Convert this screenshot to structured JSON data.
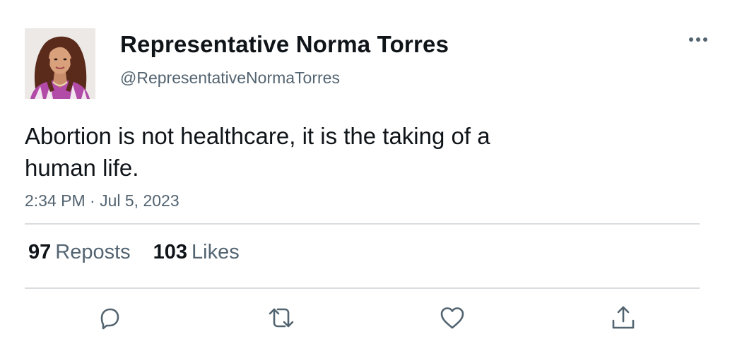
{
  "author": {
    "display_name": "Representative Norma Torres",
    "handle": "@RepresentativeNormaTorres",
    "avatar": "profile-photo"
  },
  "tweet": {
    "text": "Abortion is not healthcare, it is the taking of a human life.",
    "timestamp": "2:34 PM · Jul 5, 2023"
  },
  "stats": {
    "reposts_count": "97",
    "reposts_label": "Reposts",
    "likes_count": "103",
    "likes_label": "Likes"
  },
  "actions": [
    {
      "icon": "reply-icon"
    },
    {
      "icon": "repost-icon"
    },
    {
      "icon": "like-icon"
    },
    {
      "icon": "share-icon"
    }
  ],
  "colors": {
    "text_primary": "#0f1419",
    "text_secondary": "#536471",
    "divider": "#dadde0",
    "icon": "#536471"
  }
}
